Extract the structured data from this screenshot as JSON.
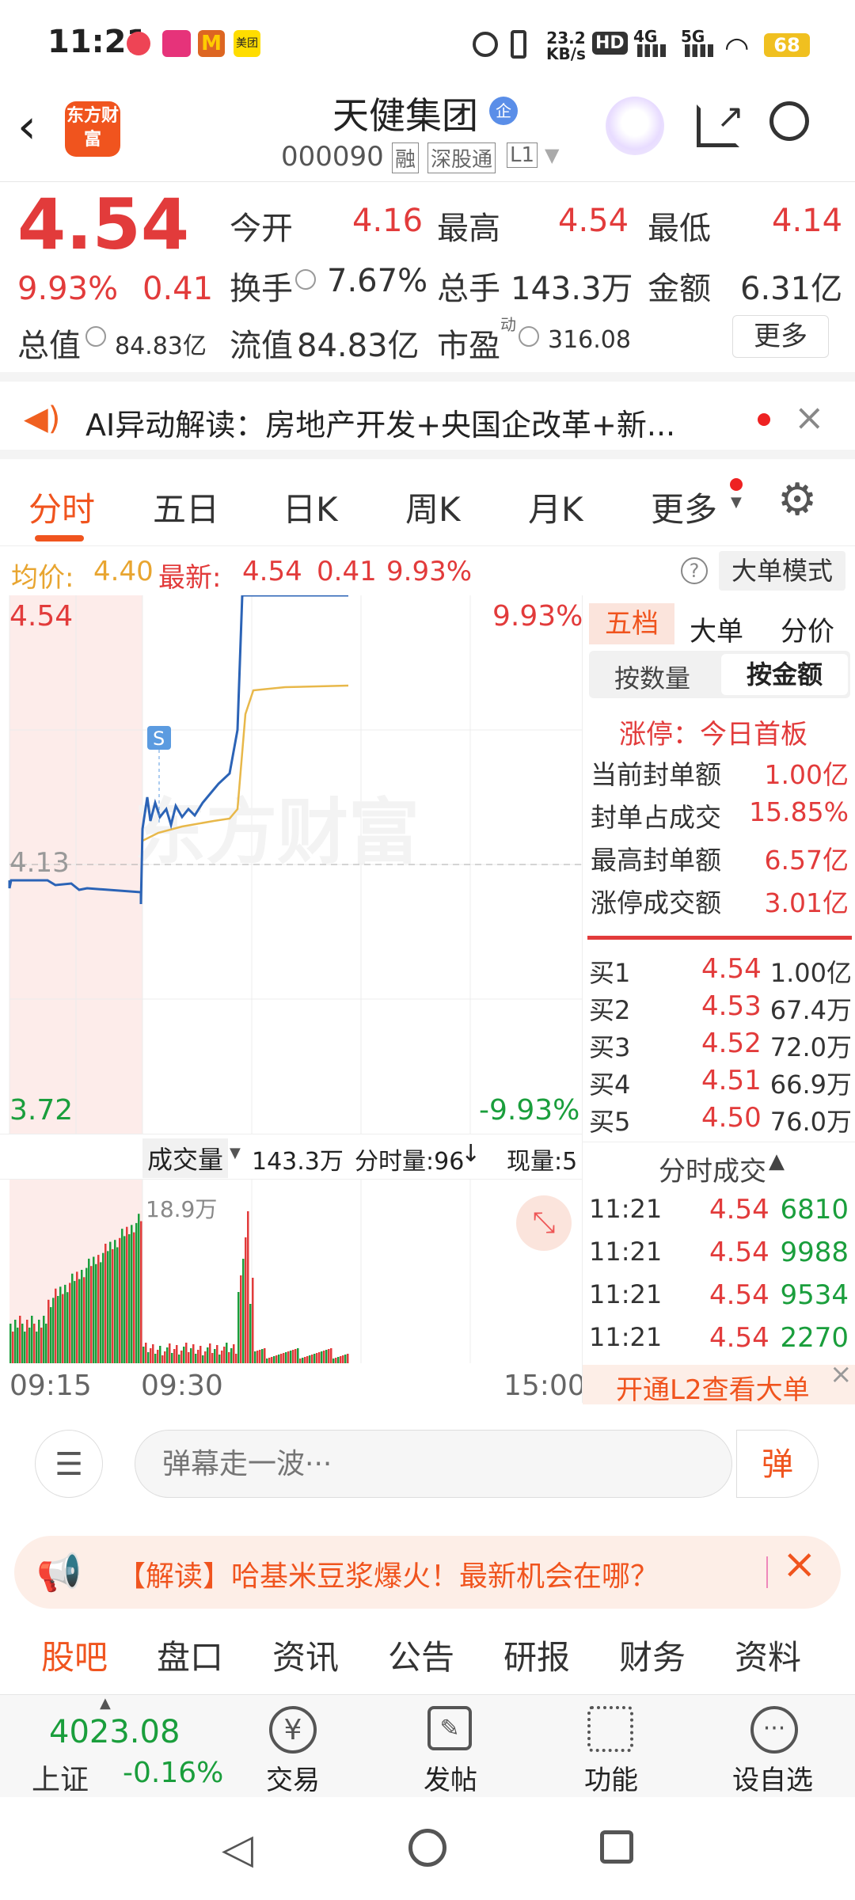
{
  "status": {
    "time": "11:21",
    "net": "23.2",
    "net_unit": "KB/s",
    "sig1": "4G",
    "sig2": "5G",
    "battery": "68",
    "app1": "lululu",
    "app2": "M",
    "app3": "美团",
    "hd": "HD"
  },
  "header": {
    "logo": "东方财富",
    "name": "天健集团",
    "badge": "企",
    "code": "000090",
    "tags": [
      "融",
      "深股通",
      "L1"
    ]
  },
  "quote": {
    "price": "4.54",
    "pct": "9.93%",
    "chg": "0.41",
    "row1": [
      {
        "k": "今开",
        "v": "4.16"
      },
      {
        "k": "最高",
        "v": "4.54"
      },
      {
        "k": "最低",
        "v": "4.14"
      }
    ],
    "row2": [
      {
        "k": "换手",
        "v": "7.67%"
      },
      {
        "k": "总手",
        "v": "143.3万"
      },
      {
        "k": "金额",
        "v": "6.31亿"
      }
    ],
    "row3": [
      {
        "k": "总值",
        "v": "84.83亿"
      },
      {
        "k": "流值",
        "v": "84.83亿"
      },
      {
        "k": "市盈",
        "sup": "动",
        "v": "316.08"
      }
    ],
    "more": "更多"
  },
  "ai": {
    "text": "AI异动解读：房地产开发+央国企改革+新..."
  },
  "tabs": [
    "分时",
    "五日",
    "日K",
    "周K",
    "月K",
    "更多"
  ],
  "info": {
    "avg_label": "均价:",
    "avg": "4.40",
    "new_label": "最新:",
    "new": "4.54",
    "chg": "0.41",
    "pct": "9.93%",
    "mode": "大单模式",
    "help": "?"
  },
  "chart": {
    "top": "4.54",
    "top_pct": "9.93%",
    "mid": "4.13",
    "bottom": "3.72",
    "bottom_pct": "-9.93%",
    "watermark": "东方财富",
    "marker": "S",
    "vol_label": "成交量",
    "vol_total": "143.3万",
    "fenshi_label": "分时量:96",
    "xianliang": "现量:5",
    "vol_max": "18.9万",
    "times": [
      "09:15",
      "09:30",
      "15:00"
    ]
  },
  "side": {
    "tabs": [
      "五档",
      "大单",
      "分价"
    ],
    "sub": [
      "按数量",
      "按金额"
    ],
    "limit_title": "涨停：今日首板",
    "limit_rows": [
      {
        "k": "当前封单额",
        "v": "1.00亿"
      },
      {
        "k": "封单占成交",
        "v": "15.85%"
      },
      {
        "k": "最高封单额",
        "v": "6.57亿"
      },
      {
        "k": "涨停成交额",
        "v": "3.01亿"
      }
    ],
    "bids": [
      {
        "k": "买1",
        "p": "4.54",
        "v": "1.00亿"
      },
      {
        "k": "买2",
        "p": "4.53",
        "v": "67.4万"
      },
      {
        "k": "买3",
        "p": "4.52",
        "v": "72.0万"
      },
      {
        "k": "买4",
        "p": "4.51",
        "v": "66.9万"
      },
      {
        "k": "买5",
        "p": "4.50",
        "v": "76.0万"
      }
    ],
    "ticks_title": "分时成交",
    "ticks": [
      {
        "t": "11:21",
        "p": "4.54",
        "v": "6810"
      },
      {
        "t": "11:21",
        "p": "4.54",
        "v": "9988"
      },
      {
        "t": "11:21",
        "p": "4.54",
        "v": "9534"
      },
      {
        "t": "11:21",
        "p": "4.54",
        "v": "2270"
      }
    ],
    "l2": "开通L2查看大单"
  },
  "barrage": {
    "placeholder": "弹幕走一波···",
    "btn": "弹"
  },
  "banner": {
    "text": "【解读】哈基米豆浆爆火！最新机会在哪？"
  },
  "bottomtabs": [
    "股吧",
    "盘口",
    "资讯",
    "公告",
    "研报",
    "财务",
    "资料"
  ],
  "toolbar": {
    "index_val": "4023.08",
    "index_name": "上证",
    "index_chg": "-0.16%",
    "items": [
      "交易",
      "发帖",
      "功能",
      "设自选"
    ]
  }
}
